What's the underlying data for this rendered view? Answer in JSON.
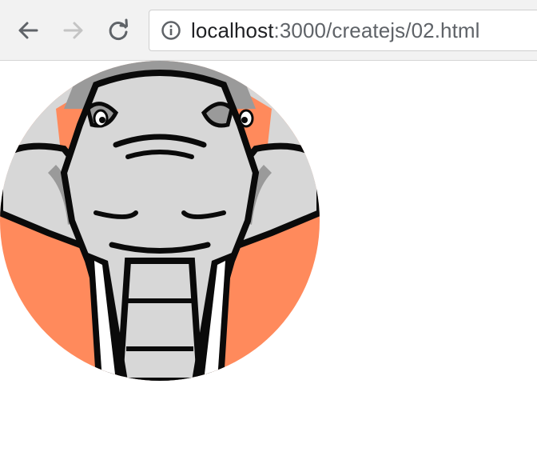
{
  "browser": {
    "toolbar": {
      "back_icon": "arrow-left-icon",
      "forward_icon": "arrow-right-icon",
      "reload_icon": "reload-icon",
      "info_icon": "info-circle-icon"
    },
    "address_bar": {
      "host": "localhost",
      "path": ":3000/createjs/02.html"
    }
  },
  "page": {
    "image_icon": "elephant-head-icon",
    "colors": {
      "circle_background": "#ff8a5c",
      "elephant_skin": "#d7d7d7",
      "elephant_shadow": "#9a9a9a",
      "outline": "#0a0a0a"
    }
  }
}
